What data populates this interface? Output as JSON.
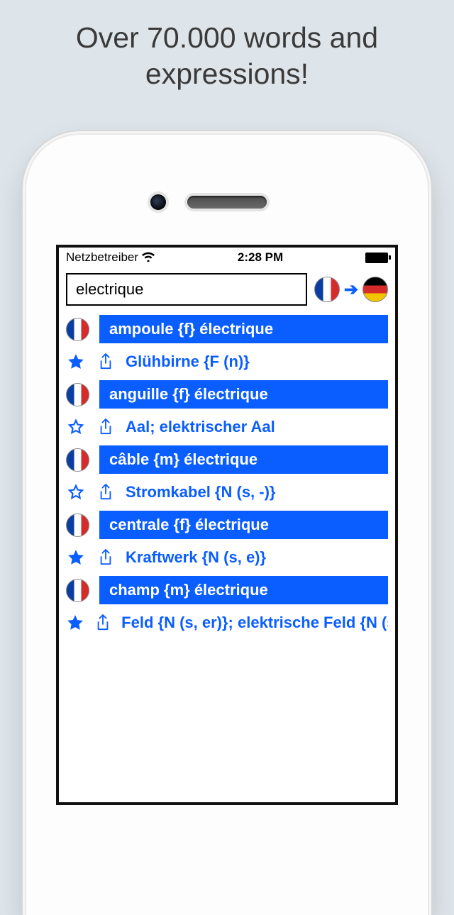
{
  "headline": "Over 70.000 words and expressions!",
  "statusbar": {
    "carrier": "Netzbetreiber",
    "time": "2:28 PM"
  },
  "search": {
    "value": "electrique",
    "from_flag": "fr",
    "to_flag": "de"
  },
  "entries": [
    {
      "source": "ampoule {f} électrique",
      "translation": "Glühbirne {F (n)}",
      "starred": true
    },
    {
      "source": "anguille {f} électrique",
      "translation": "Aal; elektrischer Aal",
      "starred": false
    },
    {
      "source": "câble {m} électrique",
      "translation": "Stromkabel {N (s, -)}",
      "starred": false
    },
    {
      "source": "centrale {f} électrique",
      "translation": "Kraftwerk {N (s, e)}",
      "starred": true
    },
    {
      "source": "champ {m} électrique",
      "translation": "Feld {N (s, er)}; elektrische Feld {N (s, er)}",
      "starred": true
    }
  ]
}
